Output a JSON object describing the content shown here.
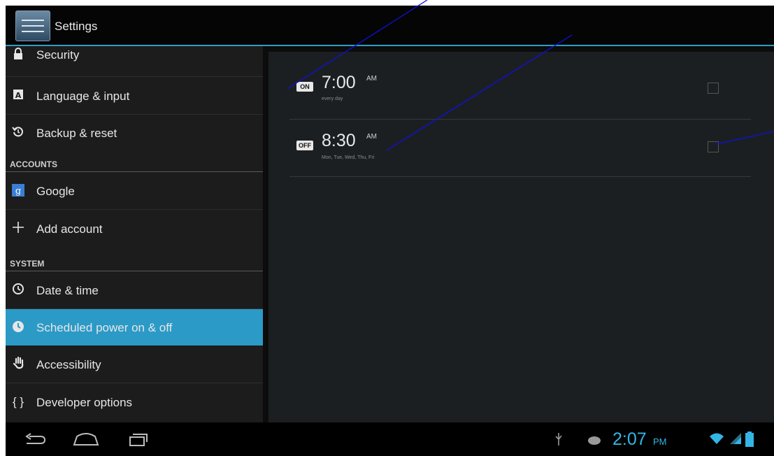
{
  "app": {
    "title": "Settings"
  },
  "sidebar": {
    "items": [
      {
        "label": "Security",
        "icon": "lock-icon"
      },
      {
        "label": "Language & input",
        "icon": "keyboard-a-icon"
      },
      {
        "label": "Backup & reset",
        "icon": "restore-icon"
      },
      {
        "label": "Google",
        "icon": "google-icon"
      },
      {
        "label": "Add account",
        "icon": "plus-icon"
      },
      {
        "label": "Date & time",
        "icon": "clock-icon"
      },
      {
        "label": "Scheduled power on & off",
        "icon": "power-clock-icon",
        "selected": true
      },
      {
        "label": "Accessibility",
        "icon": "hand-icon"
      },
      {
        "label": "Developer options",
        "icon": "braces-icon"
      }
    ],
    "headers": {
      "accounts": "ACCOUNTS",
      "system": "SYSTEM"
    }
  },
  "schedules": [
    {
      "state": "ON",
      "time": "7:00",
      "ampm": "AM",
      "days": "every day"
    },
    {
      "state": "OFF",
      "time": "8:30",
      "ampm": "AM",
      "days": "Mon, Tue, Wed, Thu, Fri"
    }
  ],
  "statusbar": {
    "time": "2:07",
    "ampm": "PM"
  },
  "colors": {
    "accent": "#2b9ac7",
    "status": "#33b5e5"
  }
}
